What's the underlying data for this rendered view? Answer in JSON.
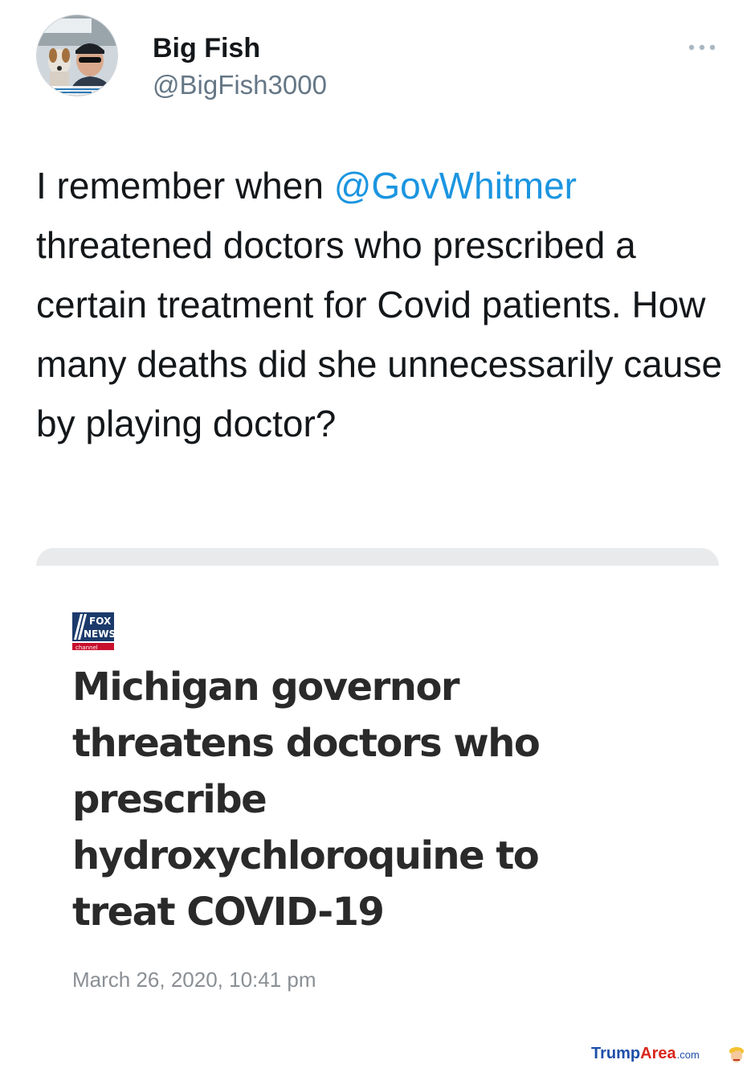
{
  "tweet": {
    "author": {
      "display_name": "Big Fish",
      "handle": "@BigFish3000",
      "avatar_icon": "profile-photo"
    },
    "more_icon": "ellipsis-icon",
    "text_before_mention": "I remember when ",
    "mention": "@GovWhitmer",
    "text_after_mention": " threatened doctors who prescribed a certain treatment for Covid patients. How many deaths did she unnecessarily cause by playing doctor?",
    "mention_color": "#1b95e0"
  },
  "card": {
    "logo_icon": "fox-news-logo",
    "logo_text": "FOX NEWS channel",
    "headline": "Michigan governor threatens doctors who prescribe hydroxychloroquine to treat COVID-19",
    "timestamp": "March 26, 2020, 10:41 pm"
  },
  "watermark": {
    "part1": "Trump",
    "part2": "Area",
    "part3": ".com",
    "icon": "trump-face-icon"
  }
}
